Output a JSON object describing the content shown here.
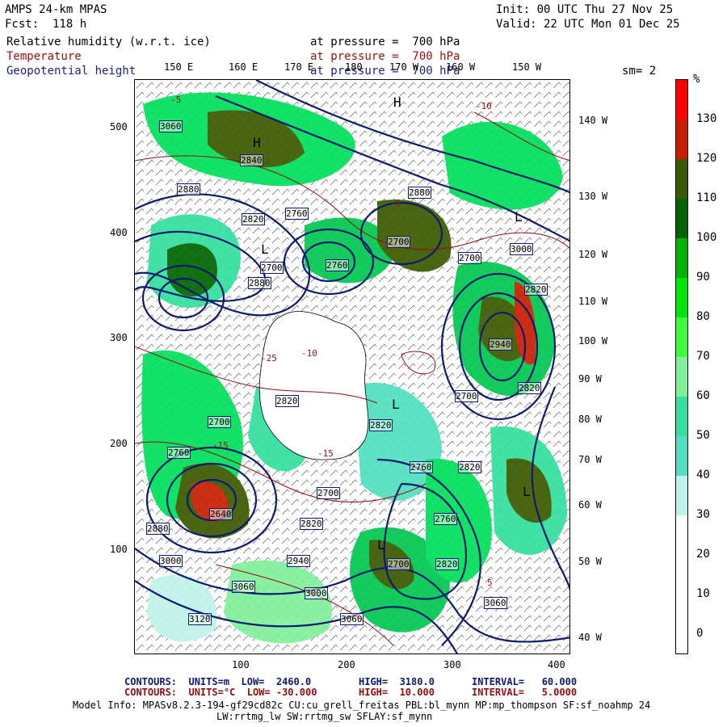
{
  "header": {
    "model": "AMPS 24-km MPAS",
    "forecast": "Fcst:  118 h",
    "init": "Init: 00 UTC Thu 27 Nov 25",
    "valid": "Valid: 22 UTC Mon 01 Dec 25",
    "field1": "Relative humidity (w.r.t. ice)",
    "field1_level": "at pressure =  700 hPa",
    "field2": "Temperature",
    "field2_level": "at pressure =  700 hPa",
    "field3": "Geopotential height",
    "field3_level": "at pressure =  700 hPa",
    "smoothing": "sm= 2"
  },
  "axes": {
    "x_ticks": [
      "100",
      "200",
      "300",
      "400"
    ],
    "y_ticks": [
      "500",
      "400",
      "300",
      "200",
      "100"
    ],
    "top_lon": [
      "150 E",
      "160 E",
      "170 E",
      "180",
      "170 W",
      "160 W",
      "150 W"
    ],
    "right_lon": [
      "140 W",
      "130 W",
      "120 W",
      "110 W",
      "100 W",
      "90 W",
      "80 W",
      "70 W",
      "60 W",
      "50 W",
      "40 W"
    ]
  },
  "colorbar": {
    "unit": "%",
    "labels": [
      "130",
      "120",
      "110",
      "100",
      "90",
      "80",
      "70",
      "60",
      "50",
      "40",
      "30",
      "20",
      "10",
      "0"
    ],
    "colors": [
      "#ff0000",
      "#c81e00",
      "#3c5a00",
      "#006400",
      "#00b400",
      "#00e600",
      "#3cff3c",
      "#80f09a",
      "#33e0a0",
      "#50e0c0",
      "#bff2ea",
      "#ffffff",
      "#ffffff",
      "#ffffff"
    ]
  },
  "map": {
    "height_labels": [
      "3060",
      "2840",
      "2880",
      "2820",
      "2760",
      "2700",
      "2760",
      "2700",
      "2880",
      "3000",
      "2700",
      "2940",
      "2820",
      "2820",
      "2700",
      "2820",
      "2700",
      "2820",
      "2760",
      "2820",
      "2760",
      "2700",
      "2640",
      "2820",
      "2880",
      "2940",
      "3000",
      "3060",
      "3120",
      "3000",
      "3060",
      "3060",
      "2820",
      "2760",
      "2880",
      "2700"
    ],
    "temp_labels": [
      "-10",
      "-15",
      "-25",
      "-5",
      "5",
      "-10",
      "-15",
      "-5"
    ],
    "highs": [
      "H",
      "H"
    ],
    "lows": [
      "L",
      "L",
      "L",
      "L",
      "L"
    ]
  },
  "footer": {
    "line1_label": "CONTOURS:  UNITS=m  LOW=  2460.0",
    "line1_high": "HIGH=  3180.0",
    "line1_interval": "INTERVAL=   60.000",
    "line2_label": "CONTOURS:  UNITS=°C  LOW= -30.000",
    "line2_high": "HIGH=  10.000",
    "line2_interval": "INTERVAL=   5.0000",
    "model_info": "Model Info: MPASv8.2.3-194-gf29cd82c CU:cu_grell_freitas PBL:bl_mynn MP:mp_thompson SF:sf_noahmp 24",
    "model_info2": "LW:rrtmg_lw SW:rrtmg_sw SFLAY:sf_mynn"
  }
}
